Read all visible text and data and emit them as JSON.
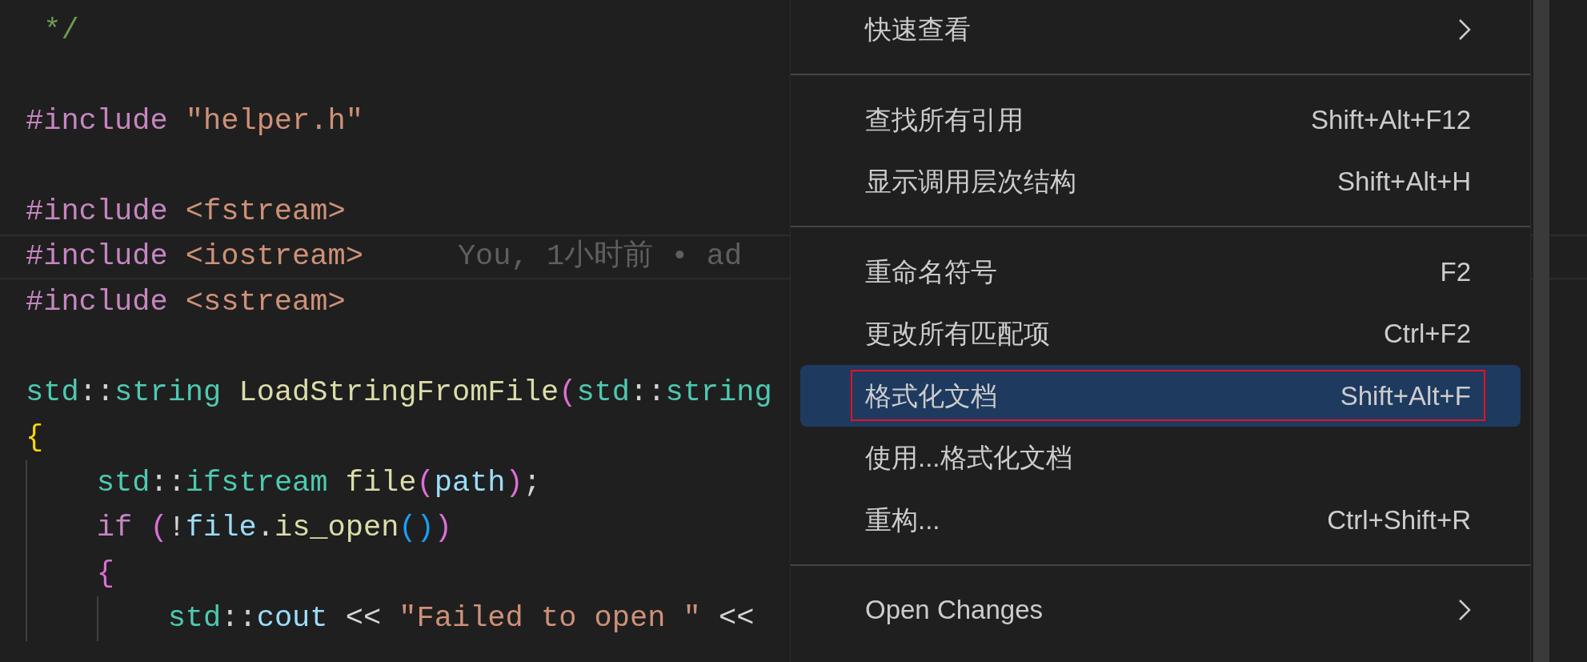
{
  "editor": {
    "lines": [
      {
        "blank_after": true,
        "tokens": [
          {
            "kind": "comment",
            "text": " */"
          }
        ]
      },
      {
        "blank_after": true,
        "tokens": [
          {
            "kind": "directive",
            "text": "#include "
          },
          {
            "kind": "string",
            "text": "\"helper.h\""
          }
        ]
      },
      {
        "tokens": [
          {
            "kind": "directive",
            "text": "#include "
          },
          {
            "kind": "string",
            "text": "<fstream>"
          }
        ]
      },
      {
        "current": true,
        "blame": "You, 1小时前 • ad",
        "tokens": [
          {
            "kind": "directive",
            "text": "#include "
          },
          {
            "kind": "string",
            "text": "<iostream>"
          }
        ]
      },
      {
        "blank_after": true,
        "tokens": [
          {
            "kind": "directive",
            "text": "#include "
          },
          {
            "kind": "string",
            "text": "<sstream>"
          }
        ]
      },
      {
        "tokens": [
          {
            "kind": "type",
            "text": "std"
          },
          {
            "kind": "plain",
            "text": "::"
          },
          {
            "kind": "type",
            "text": "string "
          },
          {
            "kind": "function",
            "text": "LoadStringFromFile"
          },
          {
            "kind": "bracket1",
            "text": "("
          },
          {
            "kind": "type",
            "text": "std"
          },
          {
            "kind": "plain",
            "text": "::"
          },
          {
            "kind": "type",
            "text": "string"
          }
        ]
      },
      {
        "tokens": [
          {
            "kind": "brace",
            "text": "{"
          }
        ]
      },
      {
        "tokens": [
          {
            "kind": "type",
            "text": "    std"
          },
          {
            "kind": "plain",
            "text": "::"
          },
          {
            "kind": "type",
            "text": "ifstream "
          },
          {
            "kind": "function",
            "text": "file"
          },
          {
            "kind": "bracket1",
            "text": "("
          },
          {
            "kind": "variable",
            "text": "path"
          },
          {
            "kind": "bracket1",
            "text": ")"
          },
          {
            "kind": "plain",
            "text": ";"
          }
        ]
      },
      {
        "tokens": [
          {
            "kind": "keyword",
            "text": "    if "
          },
          {
            "kind": "bracket1",
            "text": "("
          },
          {
            "kind": "plain",
            "text": "!"
          },
          {
            "kind": "variable",
            "text": "file"
          },
          {
            "kind": "plain",
            "text": "."
          },
          {
            "kind": "function",
            "text": "is_open"
          },
          {
            "kind": "bracket2",
            "text": "()"
          },
          {
            "kind": "bracket1",
            "text": ")"
          }
        ]
      },
      {
        "tokens": [
          {
            "kind": "bracket1",
            "text": "    {"
          }
        ]
      },
      {
        "tokens": [
          {
            "kind": "type",
            "text": "        std"
          },
          {
            "kind": "plain",
            "text": "::"
          },
          {
            "kind": "variable",
            "text": "cout"
          },
          {
            "kind": "plain",
            "text": " << "
          },
          {
            "kind": "string",
            "text": "\"Failed to open \""
          },
          {
            "kind": "plain",
            "text": " <<"
          }
        ]
      }
    ]
  },
  "context_menu": {
    "groups": [
      [
        {
          "label": "快速查看",
          "submenu": true,
          "selected": false,
          "outlined": false
        }
      ],
      [
        {
          "label": "查找所有引用",
          "shortcut": "Shift+Alt+F12",
          "submenu": false,
          "selected": false,
          "outlined": false
        },
        {
          "label": "显示调用层次结构",
          "shortcut": "Shift+Alt+H",
          "submenu": false,
          "selected": false,
          "outlined": false
        }
      ],
      [
        {
          "label": "重命名符号",
          "shortcut": "F2",
          "submenu": false,
          "selected": false,
          "outlined": false
        },
        {
          "label": "更改所有匹配项",
          "shortcut": "Ctrl+F2",
          "submenu": false,
          "selected": false,
          "outlined": false
        },
        {
          "label": "格式化文档",
          "shortcut": "Shift+Alt+F",
          "submenu": false,
          "selected": true,
          "outlined": true
        },
        {
          "label": "使用...格式化文档",
          "submenu": false,
          "selected": false,
          "outlined": false
        },
        {
          "label": "重构...",
          "shortcut": "Ctrl+Shift+R",
          "submenu": false,
          "selected": false,
          "outlined": false
        }
      ],
      [
        {
          "label": "Open Changes",
          "submenu": true,
          "selected": false,
          "outlined": false
        }
      ]
    ]
  }
}
